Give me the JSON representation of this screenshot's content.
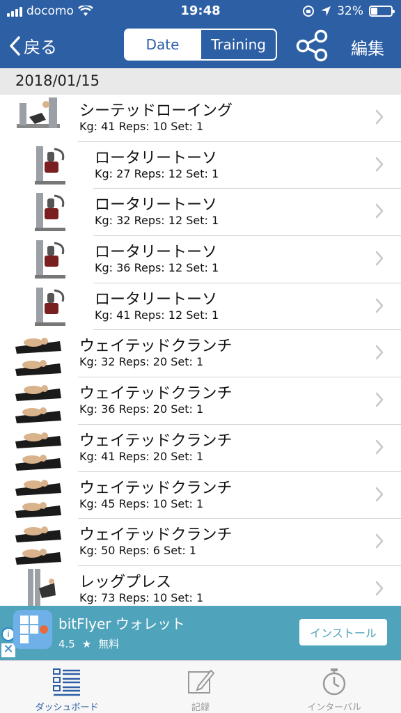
{
  "status": {
    "carrier": "docomo",
    "time": "19:48",
    "battery": "32%",
    "battery_level": 0.32,
    "icons": [
      "signal-icon",
      "wifi-icon",
      "lock-rotation-icon",
      "location-icon",
      "battery-icon"
    ]
  },
  "nav": {
    "back_label": "戻る",
    "segments": [
      "Date",
      "Training"
    ],
    "selected_segment": "Date",
    "edit_label": "編集"
  },
  "section": {
    "date": "2018/01/15"
  },
  "rows": [
    {
      "name": "シーテッドローイング",
      "detail": "Kg: 41 Reps: 10 Set: 1",
      "image": "seated-row-machine"
    },
    {
      "name": "ロータリートーソ",
      "detail": "Kg: 27 Reps: 12 Set: 1",
      "image": "rotary-torso-machine"
    },
    {
      "name": "ロータリートーソ",
      "detail": "Kg: 32 Reps: 12 Set: 1",
      "image": "rotary-torso-machine"
    },
    {
      "name": "ロータリートーソ",
      "detail": "Kg: 36 Reps: 12 Set: 1",
      "image": "rotary-torso-machine"
    },
    {
      "name": "ロータリートーソ",
      "detail": "Kg: 41 Reps: 12 Set: 1",
      "image": "rotary-torso-machine"
    },
    {
      "name": "ウェイテッドクランチ",
      "detail": "Kg: 32 Reps: 20 Set: 1",
      "image": "weighted-crunch"
    },
    {
      "name": "ウェイテッドクランチ",
      "detail": "Kg: 36 Reps: 20 Set: 1",
      "image": "weighted-crunch"
    },
    {
      "name": "ウェイテッドクランチ",
      "detail": "Kg: 41 Reps: 20 Set: 1",
      "image": "weighted-crunch"
    },
    {
      "name": "ウェイテッドクランチ",
      "detail": "Kg: 45 Reps: 10 Set: 1",
      "image": "weighted-crunch"
    },
    {
      "name": "ウェイテッドクランチ",
      "detail": "Kg: 50 Reps: 6 Set: 1",
      "image": "weighted-crunch"
    },
    {
      "name": "レッグプレス",
      "detail": "Kg: 73 Reps: 10 Set: 1",
      "image": "leg-press-machine"
    }
  ],
  "ad": {
    "title": "bitFlyer ウォレット",
    "rating": "4.5",
    "price": "無料",
    "install_label": "インストール",
    "colors": {
      "background": "#4fa3bb"
    }
  },
  "tabs": [
    {
      "label": "ダッシュボード",
      "icon": "dashboard-icon",
      "active": true
    },
    {
      "label": "記録",
      "icon": "edit-note-icon",
      "active": false
    },
    {
      "label": "インターバル",
      "icon": "stopwatch-icon",
      "active": false
    }
  ],
  "colors": {
    "header": "#2d5fa4",
    "section": "#e9e9e9",
    "accent": "#2d5fa4"
  }
}
